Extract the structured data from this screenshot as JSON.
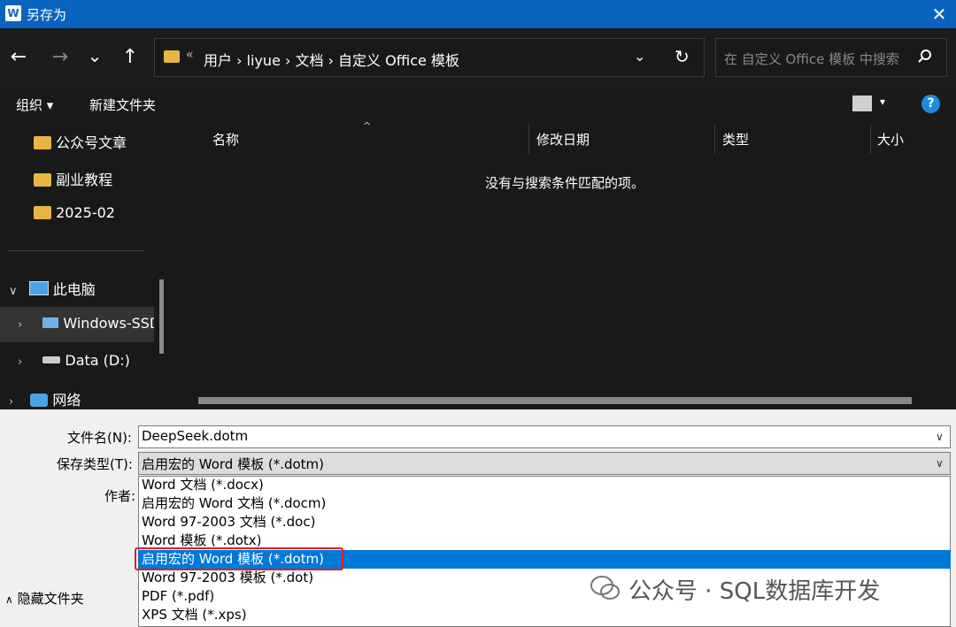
{
  "window": {
    "title": "另存为",
    "app_icon": "W"
  },
  "nav": {
    "back_icon": "←",
    "forward_icon": "→",
    "recent_icon": "⌄",
    "up_icon": "↑",
    "breadcrumb_prefix": "«",
    "breadcrumb": "用户  ›  liyue  ›  文档  ›  自定义 Office 模板",
    "search_placeholder": "在 自定义 Office 模板 中搜索"
  },
  "toolbar": {
    "organize": "组织 ▾",
    "new_folder": "新建文件夹",
    "help": "?"
  },
  "sidebar": {
    "items": [
      {
        "label": "公众号文章"
      },
      {
        "label": "副业教程"
      },
      {
        "label": "2025-02"
      },
      {
        "label": "此电脑"
      },
      {
        "label": "Windows-SSD"
      },
      {
        "label": "Data (D:)"
      },
      {
        "label": "网络"
      }
    ]
  },
  "columns": [
    "名称",
    "修改日期",
    "类型",
    "大小"
  ],
  "empty_message": "没有与搜索条件匹配的项。",
  "form": {
    "filename_label": "文件名(N):",
    "filename_value": "DeepSeek.dotm",
    "filetype_label": "保存类型(T):",
    "filetype_value": "启用宏的 Word 模板 (*.dotm)",
    "author_label": "作者:"
  },
  "filetype_options": [
    "Word 文档 (*.docx)",
    "启用宏的 Word 文档 (*.docm)",
    "Word 97-2003 文档 (*.doc)",
    "Word 模板 (*.dotx)",
    "启用宏的 Word 模板 (*.dotm)",
    "Word 97-2003 模板 (*.dot)",
    "PDF (*.pdf)",
    "XPS 文档 (*.xps)"
  ],
  "selected_option_index": 4,
  "hide_folders": "隐藏文件夹",
  "watermark": "公众号 · SQL数据库开发",
  "colors": {
    "titlebar": "#0a64bf",
    "selection": "#0078d7",
    "highlight_box": "#e02020",
    "folder": "#e8b640"
  }
}
